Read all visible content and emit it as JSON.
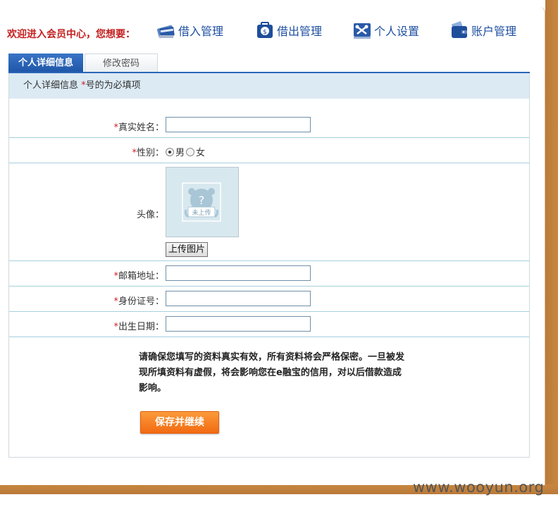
{
  "header": {
    "welcome": "欢迎进入会员中心，您想要：",
    "nav": [
      {
        "label": "借入管理",
        "icon": "credit-card-icon"
      },
      {
        "label": "借出管理",
        "icon": "money-bag-icon"
      },
      {
        "label": "个人设置",
        "icon": "tools-icon"
      },
      {
        "label": "账户管理",
        "icon": "wallet-icon"
      }
    ]
  },
  "tabs": [
    {
      "label": "个人详细信息",
      "active": true
    },
    {
      "label": "修改密码",
      "active": false
    }
  ],
  "form": {
    "header_title": "个人详细信息",
    "header_required_mark": "*",
    "header_required_note": "号的为必填项",
    "required_mark": "*",
    "fields": {
      "real_name": {
        "label": "真实姓名：",
        "value": ""
      },
      "gender": {
        "label": "性别：",
        "options": [
          "男",
          "女"
        ],
        "selected": "男"
      },
      "avatar": {
        "label": "头像：",
        "upload_label": "上传图片",
        "placeholder_text": "未上传"
      },
      "email": {
        "label": "邮箱地址：",
        "value": ""
      },
      "id_number": {
        "label": "身份证号：",
        "value": ""
      },
      "birth_date": {
        "label": "出生日期：",
        "value": ""
      }
    },
    "notice": "请确保您填写的资料真实有效，所有资料将会严格保密。一旦被发现所填资料有虚假，将会影响您在e融宝的信用，对以后借款造成影响。",
    "save_label": "保存并继续"
  },
  "watermark": "www.wooyun.org",
  "colors": {
    "accent_blue": "#1e56a8",
    "required_red": "#d0202a",
    "save_orange": "#f26a12",
    "frame_brown": "#c8873f"
  }
}
